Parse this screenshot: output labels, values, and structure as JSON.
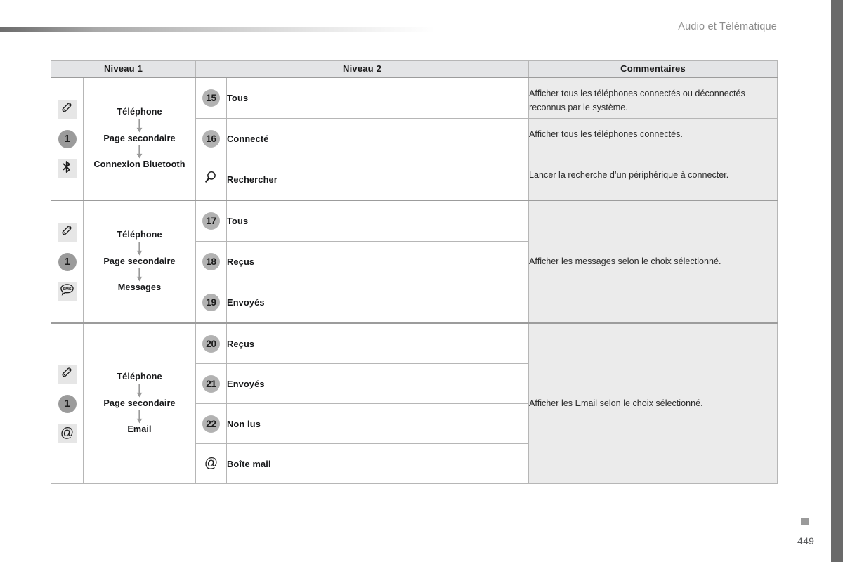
{
  "page": {
    "header_title": "Audio et Télématique",
    "page_number": "449"
  },
  "table": {
    "headers": {
      "level1": "Niveau 1",
      "level2": "Niveau 2",
      "comments": "Commentaires"
    },
    "groups": [
      {
        "icons": [
          {
            "name": "phone-handset-icon",
            "glyph": "handset"
          },
          {
            "name": "step-number-badge",
            "glyph": "1"
          },
          {
            "name": "bluetooth-icon",
            "glyph": "bluetooth"
          }
        ],
        "nav": [
          "Téléphone",
          "Page secondaire",
          "Connexion Bluetooth"
        ],
        "rows": [
          {
            "badge": "15",
            "badge_type": "number",
            "label": "Tous",
            "comment": "Afficher tous les téléphones connectés ou déconnectés reconnus par le système."
          },
          {
            "badge": "16",
            "badge_type": "number",
            "label": "Connecté",
            "comment": "Afficher tous les téléphones connectés."
          },
          {
            "badge": "search-icon",
            "badge_type": "icon",
            "label": "Rechercher",
            "comment": "Lancer la recherche d’un périphérique à connecter."
          }
        ],
        "merged_comment": null
      },
      {
        "icons": [
          {
            "name": "phone-handset-icon",
            "glyph": "handset"
          },
          {
            "name": "step-number-badge",
            "glyph": "1"
          },
          {
            "name": "sms-icon",
            "glyph": "SMS"
          }
        ],
        "nav": [
          "Téléphone",
          "Page secondaire",
          "Messages"
        ],
        "rows": [
          {
            "badge": "17",
            "badge_type": "number",
            "label": "Tous"
          },
          {
            "badge": "18",
            "badge_type": "number",
            "label": "Reçus"
          },
          {
            "badge": "19",
            "badge_type": "number",
            "label": "Envoyés"
          }
        ],
        "merged_comment": "Afficher les messages selon le choix sélectionné."
      },
      {
        "icons": [
          {
            "name": "phone-handset-icon",
            "glyph": "handset"
          },
          {
            "name": "step-number-badge",
            "glyph": "1"
          },
          {
            "name": "at-email-icon",
            "glyph": "@"
          }
        ],
        "nav": [
          "Téléphone",
          "Page secondaire",
          "Email"
        ],
        "rows": [
          {
            "badge": "20",
            "badge_type": "number",
            "label": "Reçus"
          },
          {
            "badge": "21",
            "badge_type": "number",
            "label": "Envoyés"
          },
          {
            "badge": "22",
            "badge_type": "number",
            "label": "Non lus"
          },
          {
            "badge": "at-icon",
            "badge_type": "icon",
            "label": "Boîte mail"
          }
        ],
        "merged_comment": "Afficher les Email selon le choix sélectionné."
      }
    ]
  },
  "colors": {
    "header_fill": "#e3e4e6",
    "comment_fill": "#ebebeb",
    "badge_fill": "#b2b2b2",
    "icon_fill": "#e6e6e6",
    "border": "#b6b6b6",
    "band": "#6a6a6a"
  }
}
